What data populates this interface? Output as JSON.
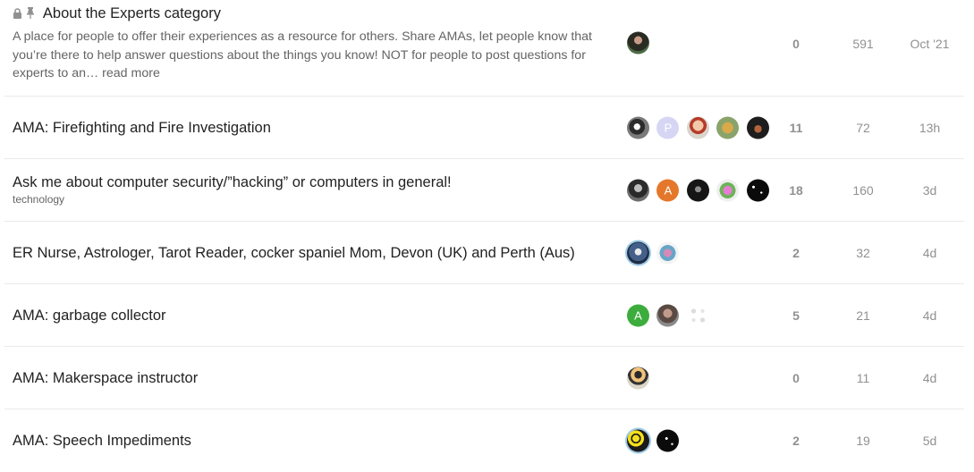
{
  "topics": [
    {
      "title": "About the Experts category",
      "excerpt": "A place for people to offer their experiences as a resource for others. Share AMAs, let people know that you’re there to help answer questions about the things you know! NOT for people to post questions for experts to an…",
      "read_more": "read more",
      "replies": "0",
      "views": "591",
      "activity": "Oct '21"
    },
    {
      "title": "AMA: Firefighting and Fire Investigation",
      "replies": "11",
      "views": "72",
      "activity": "13h"
    },
    {
      "title": "Ask me about computer security/”hacking” or computers in general!",
      "tag": "technology",
      "replies": "18",
      "views": "160",
      "activity": "3d"
    },
    {
      "title": "ER Nurse, Astrologer, Tarot Reader, cocker spaniel Mom, Devon (UK) and Perth (Aus)",
      "replies": "2",
      "views": "32",
      "activity": "4d"
    },
    {
      "title": "AMA: garbage collector",
      "replies": "5",
      "views": "21",
      "activity": "4d"
    },
    {
      "title": "AMA: Makerspace instructor",
      "replies": "0",
      "views": "11",
      "activity": "4d"
    },
    {
      "title": "AMA: Speech Impediments",
      "replies": "2",
      "views": "19",
      "activity": "5d"
    }
  ],
  "avatar_letters": {
    "p": "P",
    "a_orange": "A",
    "a_green": "A"
  },
  "colors": {
    "letter_p": "#d6d6f4",
    "letter_a_orange": "#e5772b",
    "letter_a_green": "#3cad3c"
  }
}
